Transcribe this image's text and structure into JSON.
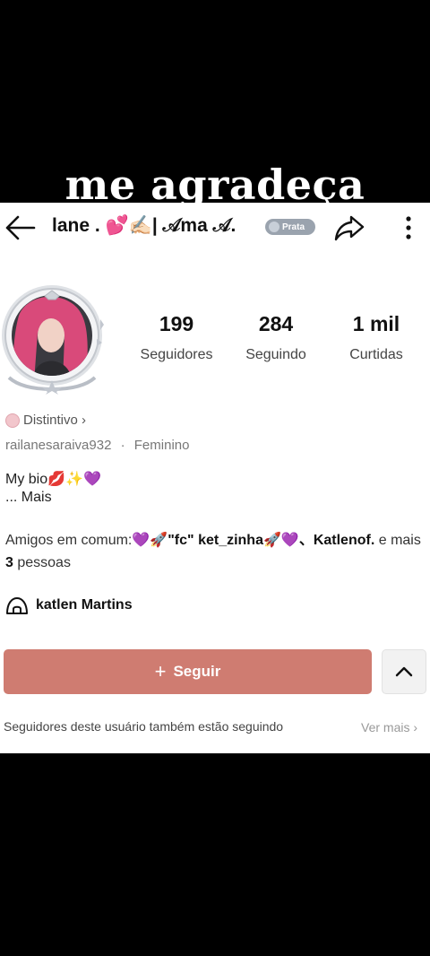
{
  "caption": "me agradeça",
  "header": {
    "title": "lane . 💕✍🏻| 𝒜ma 𝒜.",
    "badge": "Prata"
  },
  "stats": [
    {
      "value": "199",
      "label": "Seguidores"
    },
    {
      "value": "284",
      "label": "Seguindo"
    },
    {
      "value": "1 mil",
      "label": "Curtidas"
    }
  ],
  "profile": {
    "badge_link": "Distintivo ›",
    "username": "railanesaraiva932",
    "separator": "·",
    "gender": "Feminino",
    "bio_line1": "My bio💋✨💜",
    "bio_line2": "...  Mais",
    "mutual_prefix": "Amigos em comum:",
    "mutual_names": "💜🚀\"fc\" ket_zinha🚀💜、Katlenof.",
    "mutual_mid": " e mais ",
    "mutual_count": "3",
    "mutual_suffix": " pessoas",
    "location": "katlen Martins"
  },
  "actions": {
    "follow_label": "Seguir"
  },
  "suggestions": {
    "text": "Seguidores deste usuário também estão seguindo",
    "see_more": "Ver mais ›"
  }
}
